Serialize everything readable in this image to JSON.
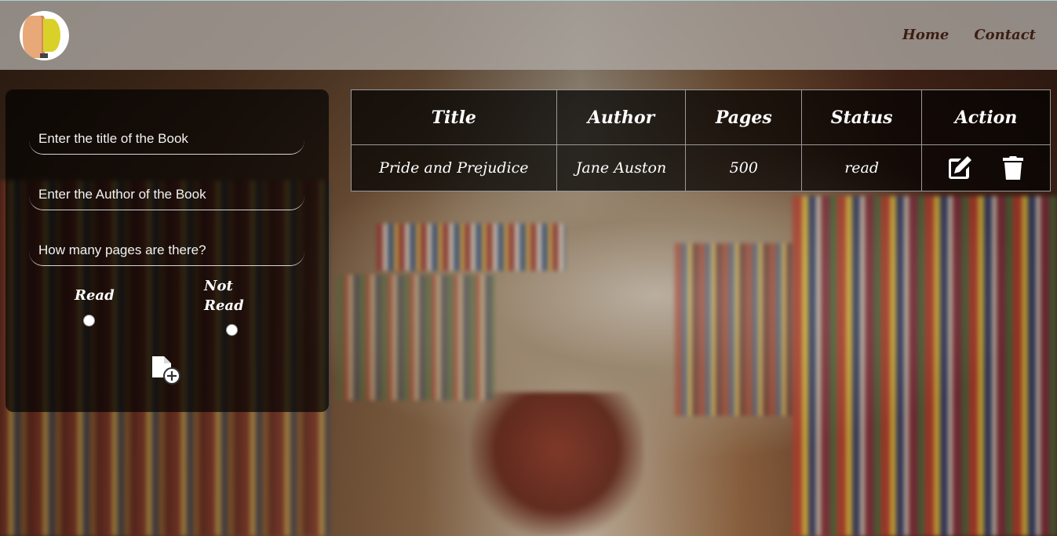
{
  "header": {
    "logo_icon": "brain-lightbulb-logo",
    "nav": [
      {
        "label": "Home"
      },
      {
        "label": "Contact"
      }
    ]
  },
  "form": {
    "title_placeholder": "Enter the title of the Book",
    "author_placeholder": "Enter the Author of the Book",
    "pages_placeholder": "How many pages are there?",
    "radio_read_label": "Read",
    "radio_notread_label": "Not Read",
    "add_icon": "add-file-icon"
  },
  "table": {
    "headers": [
      "Title",
      "Author",
      "Pages",
      "Status",
      "Action"
    ],
    "rows": [
      {
        "title": "Pride and Prejudice",
        "author": "Jane Auston",
        "pages": "500",
        "status": "read"
      }
    ],
    "edit_icon": "edit-icon",
    "delete_icon": "trash-icon"
  },
  "colors": {
    "header_bg": "#afaaa5",
    "nav_text": "#3b1d12",
    "panel_bg": "#000000"
  }
}
